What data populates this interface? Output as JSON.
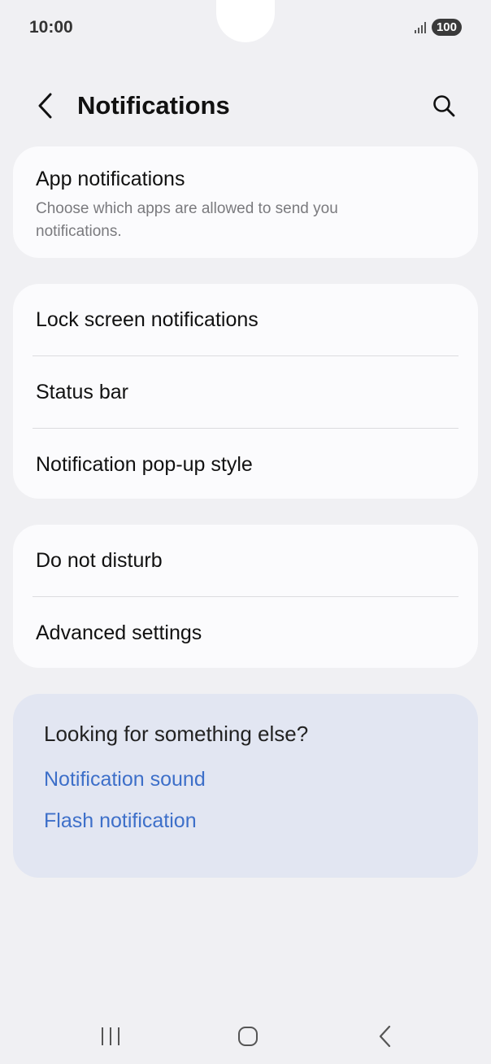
{
  "status_bar": {
    "time": "10:00",
    "battery": "100",
    "signal_icon": "signal-icon"
  },
  "header": {
    "title": "Notifications",
    "back_icon": "chevron-left-icon",
    "search_icon": "search-icon"
  },
  "app_notifications": {
    "title": "App notifications",
    "description": "Choose which apps are allowed to send you notifications."
  },
  "group1": {
    "items": [
      "Lock screen notifications",
      "Status bar",
      "Notification pop-up style"
    ]
  },
  "group2": {
    "items": [
      "Do not disturb",
      "Advanced settings"
    ]
  },
  "suggestions": {
    "question": "Looking for something else?",
    "links": [
      "Notification sound",
      "Flash notification"
    ],
    "link_color": "#3d6fc9"
  },
  "nav_bar": {
    "recent_icon": "recent-apps-icon",
    "home_icon": "home-icon",
    "back_icon": "back-icon"
  }
}
